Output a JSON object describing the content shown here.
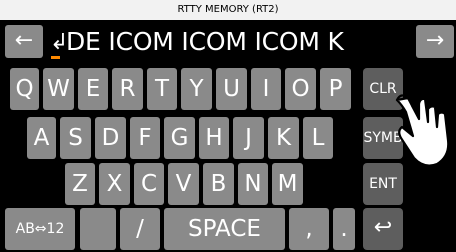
{
  "title": "RTTY MEMORY (RT2)",
  "edit": {
    "left_arrow": "←",
    "right_arrow": "→",
    "return_glyph": "↲",
    "text": "DE ICOM ICOM ICOM K"
  },
  "keyboard": {
    "row1": [
      "Q",
      "W",
      "E",
      "R",
      "T",
      "Y",
      "U",
      "I",
      "O",
      "P"
    ],
    "row2": [
      "A",
      "S",
      "D",
      "F",
      "G",
      "H",
      "J",
      "K",
      "L"
    ],
    "row3": [
      "Z",
      "X",
      "C",
      "V",
      "B",
      "N",
      "M"
    ],
    "row4": {
      "mode": "AB⇔12",
      "slash": "/",
      "space": "SPACE",
      "comma": ",",
      "period": "."
    }
  },
  "side_keys": {
    "clr": "CLR",
    "symb": "SYMB",
    "ent": "ENT",
    "back": "↩"
  },
  "colors": {
    "key": "#8a8a8a",
    "side_key": "#5e5e5e",
    "cursor": "#ff8a00",
    "title_bg": "#f2f2f2"
  },
  "icons": {
    "pointer": "hand-pointer-icon"
  }
}
